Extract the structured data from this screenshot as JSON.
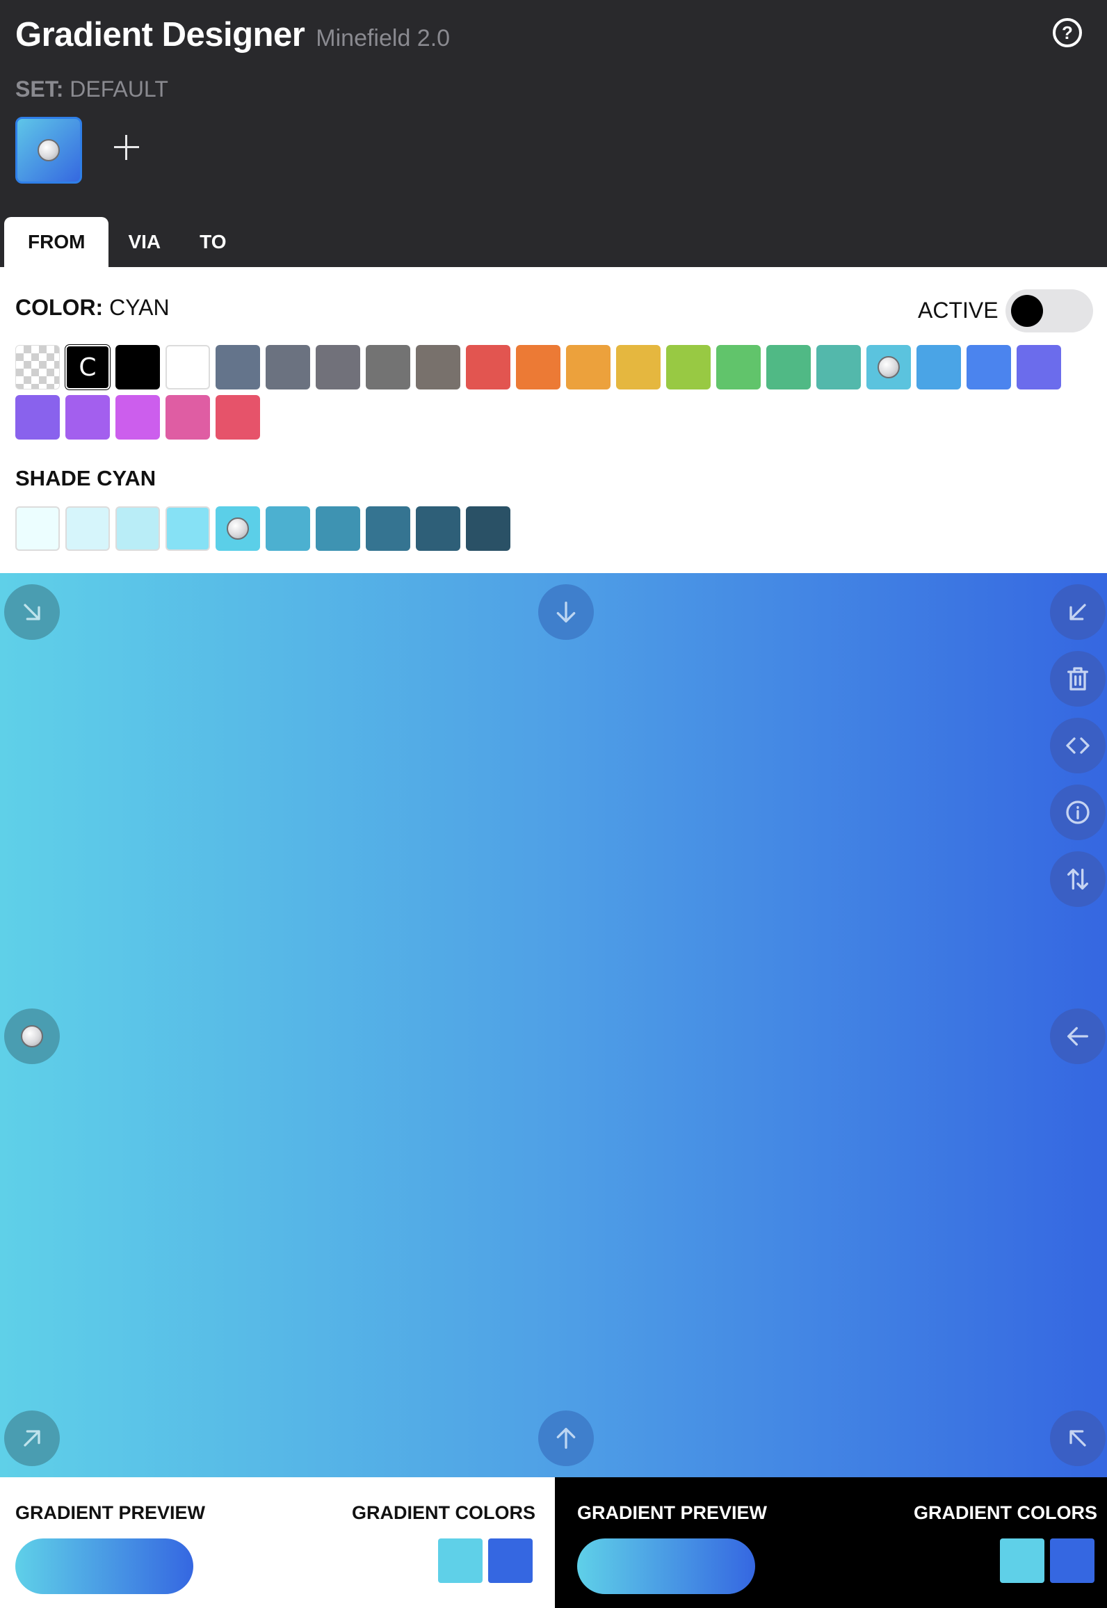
{
  "app": {
    "title": "Gradient Designer",
    "subtitle": "Minefield 2.0",
    "help_icon": "question-circle-icon",
    "help_glyph": "?"
  },
  "set": {
    "label": "SET:",
    "name": "DEFAULT"
  },
  "tabs": [
    {
      "label": "FROM",
      "active": true
    },
    {
      "label": "VIA",
      "active": false
    },
    {
      "label": "TO",
      "active": false
    }
  ],
  "color": {
    "label": "COLOR:",
    "value": "CYAN",
    "active_label": "ACTIVE",
    "custom_glyph": "C",
    "palette": [
      "transparent",
      "custom",
      "#000000",
      "#ffffff",
      "#64748b",
      "#6b7280",
      "#71717a",
      "#737373",
      "#78716c",
      "#e25550",
      "#ec7a35",
      "#eca13c",
      "#e5b73f",
      "#98c943",
      "#61c46b",
      "#50b985",
      "#53b8ab",
      "#5bc3de",
      "#4aa4e6",
      "#4b84ee",
      "#6b6cec",
      "#8962ed",
      "#a35fee",
      "#cc5eed",
      "#df5da3",
      "#e6536a"
    ],
    "selected": "#5bc3de"
  },
  "shade": {
    "label": "SHADE CYAN",
    "shades": [
      "#ecfeff",
      "#d6f5fb",
      "#b9edf7",
      "#86e1f5",
      "#5bcfe8",
      "#4cb0d0",
      "#3e93b2",
      "#357491",
      "#2e5f78",
      "#2a5166"
    ],
    "selected": "#5bcfe8"
  },
  "gradient": {
    "from": "#5fd0e8",
    "via": "#4fa0e6",
    "to": "#3567e1",
    "direction": "to right"
  },
  "canvas_icons": [
    "arrow-down-right-icon",
    "arrow-down-icon",
    "arrow-down-left-icon",
    "trash-icon",
    "code-icon",
    "info-icon",
    "swap-vertical-icon",
    "arrow-left-icon",
    "arrow-up-right-icon",
    "arrow-up-icon",
    "arrow-up-left-icon"
  ],
  "previews": {
    "light": {
      "preview_label": "GRADIENT PREVIEW",
      "colors_label": "GRADIENT COLORS"
    },
    "dark": {
      "preview_label": "GRADIENT PREVIEW",
      "colors_label": "GRADIENT COLORS"
    },
    "colors": [
      "#5fd0e8",
      "#3567e1"
    ]
  }
}
